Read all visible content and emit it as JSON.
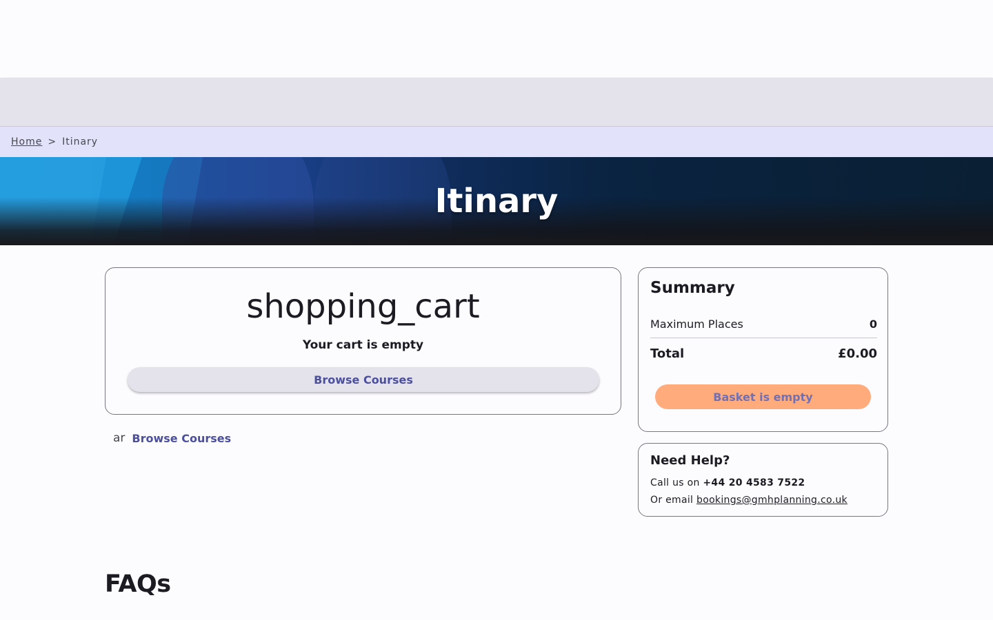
{
  "breadcrumb": {
    "home": "Home",
    "separator": ">",
    "current": "Itinary"
  },
  "hero": {
    "title": "Itinary"
  },
  "cart": {
    "icon_text": "shopping_cart",
    "empty_message": "Your cart is empty",
    "browse_button": "Browse Courses"
  },
  "under_cart": {
    "prefix": "ar",
    "browse_link": "Browse Courses"
  },
  "summary": {
    "title": "Summary",
    "places_label": "Maximum Places",
    "places_value": "0",
    "total_label": "Total",
    "total_value": "£0.00",
    "checkout_button": "Basket is empty"
  },
  "help": {
    "title": "Need Help?",
    "call_prefix": "Call us on",
    "phone": "+44 20 4583 7522",
    "email_prefix": "Or email",
    "email": "bookings@gmhplanning.co.uk"
  },
  "faqs": {
    "title": "FAQs"
  },
  "colors": {
    "accent": "#4b4f9c",
    "checkout_bg": "#ffab7c",
    "breadcrumb_bg": "#e2e2fa"
  }
}
